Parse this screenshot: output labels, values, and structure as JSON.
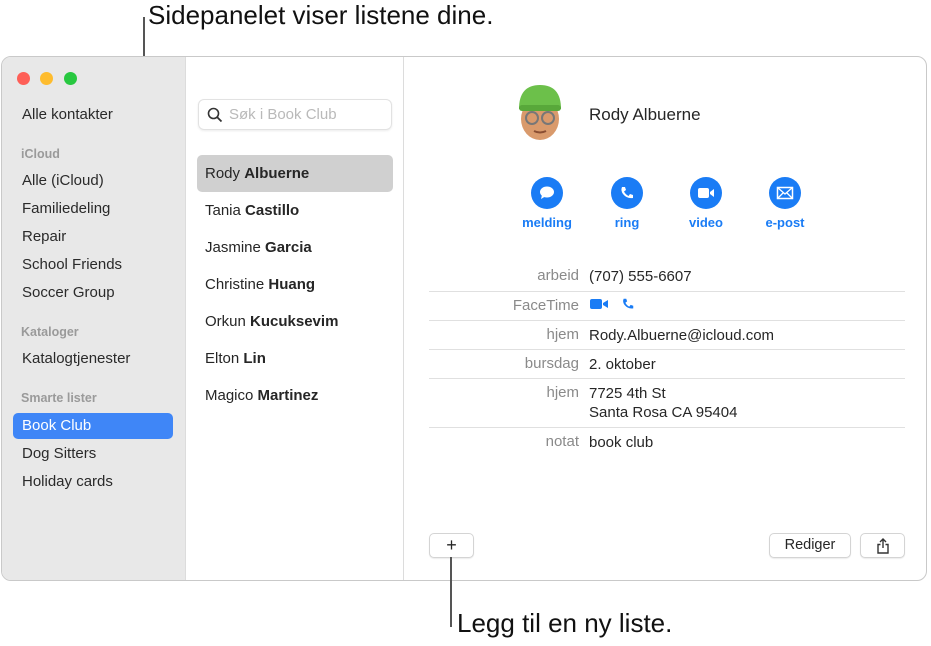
{
  "callouts": {
    "top": "Sidepanelet viser listene dine.",
    "bottom": "Legg til en ny liste."
  },
  "sidebar": {
    "all_contacts": "Alle kontakter",
    "sections": [
      {
        "header": "iCloud",
        "items": [
          "Alle (iCloud)",
          "Familiedeling",
          "Repair",
          "School Friends",
          "Soccer Group"
        ]
      },
      {
        "header": "Kataloger",
        "items": [
          "Katalogtjenester"
        ]
      },
      {
        "header": "Smarte lister",
        "items": [
          "Book Club",
          "Dog Sitters",
          "Holiday cards"
        ]
      }
    ],
    "selected": "Book Club"
  },
  "search": {
    "placeholder": "Søk i Book Club"
  },
  "contacts": [
    {
      "first": "Rody",
      "last": "Albuerne",
      "selected": true
    },
    {
      "first": "Tania",
      "last": "Castillo"
    },
    {
      "first": "Jasmine",
      "last": "Garcia"
    },
    {
      "first": "Christine",
      "last": "Huang"
    },
    {
      "first": "Orkun",
      "last": "Kucuksevim"
    },
    {
      "first": "Elton",
      "last": "Lin"
    },
    {
      "first": "Magico",
      "last": "Martinez"
    }
  ],
  "detail": {
    "name": "Rody Albuerne",
    "actions": [
      {
        "label": "melding",
        "icon": "message-icon"
      },
      {
        "label": "ring",
        "icon": "phone-icon"
      },
      {
        "label": "video",
        "icon": "video-icon"
      },
      {
        "label": "e-post",
        "icon": "mail-icon"
      }
    ],
    "fields": [
      {
        "label": "arbeid",
        "value": "(707) 555-6607"
      },
      {
        "label": "FaceTime",
        "value": ""
      },
      {
        "label": "hjem",
        "value": "Rody.Albuerne@icloud.com"
      },
      {
        "label": "bursdag",
        "value": "2. oktober"
      },
      {
        "label": "hjem",
        "value": "7725 4th St",
        "value2": "Santa Rosa CA 95404"
      },
      {
        "label": "notat",
        "value": "book club"
      }
    ],
    "add_label": "+",
    "edit_label": "Rediger"
  },
  "colors": {
    "accent": "#1a7cf5",
    "selection": "#3f86f7"
  }
}
